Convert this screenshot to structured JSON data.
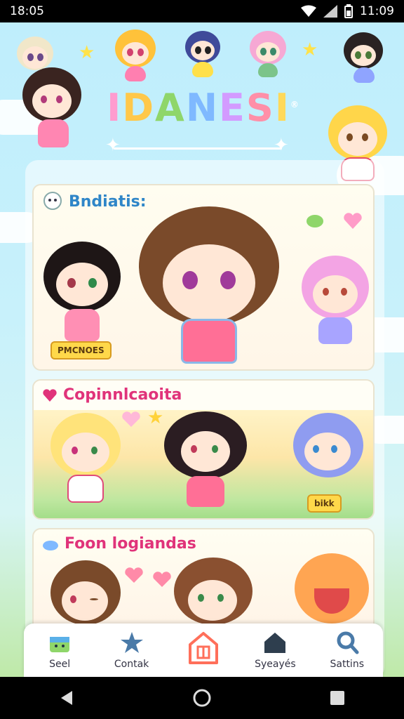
{
  "status_bar": {
    "time_left": "18:05",
    "time_right": "11:09"
  },
  "app": {
    "logo_letters": [
      "I",
      "D",
      "A",
      "N",
      "E",
      "S",
      "I"
    ],
    "logo_mark": "®"
  },
  "cards": [
    {
      "title": "Bndiatis:",
      "title_color": "#2f86c8",
      "icon": "ghost-icon",
      "sign": "PMCNOES"
    },
    {
      "title": "Copinnlcaoita",
      "title_color": "#e0337a",
      "icon": "heart-icon",
      "sign": "bikk"
    },
    {
      "title": "Foon logiandas",
      "title_color": "#e0337a",
      "icon": "cloud-icon"
    }
  ],
  "nav": [
    {
      "label": "Seel",
      "icon": "gift-icon"
    },
    {
      "label": "Contak",
      "icon": "star-icon"
    },
    {
      "label": "",
      "icon": "home-icon",
      "active": true
    },
    {
      "label": "Syeayés",
      "icon": "house-icon"
    },
    {
      "label": "Sattins",
      "icon": "search-icon"
    }
  ],
  "colors": {
    "accent": "#ff6f5a",
    "sky": "#bfeefc",
    "title_pink": "#e0337a",
    "title_blue": "#2f86c8"
  }
}
